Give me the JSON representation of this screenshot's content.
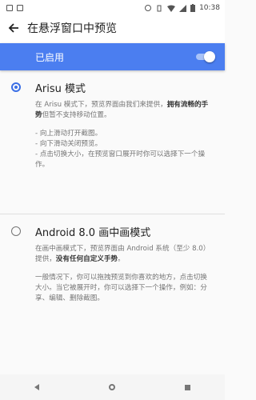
{
  "status_bar": {
    "time": "10:38"
  },
  "app_bar": {
    "title": "在悬浮窗口中预览"
  },
  "enabled_bar": {
    "label": "已启用",
    "toggle_on": true
  },
  "colors": {
    "accent": "#4b7ef0",
    "radio": "#3b6fe6"
  },
  "option1": {
    "title": "Arisu 模式",
    "desc_lead": "在 Arisu 模式下，预览界面由我们来提供，",
    "desc_bold": "拥有流畅的手势",
    "desc_tail": "但暂不支持移动位置。",
    "items": [
      "- 向上滑动打开截图。",
      "- 向下滑动关闭预览。",
      "- 点击切换大小，在预览窗口展开时你可以选择下一个操作。"
    ],
    "selected": true
  },
  "option2": {
    "title": "Android 8.0 画中画模式",
    "desc_lead": "在画中画模式下，预览界面由 Android 系统（至少 8.0）提供，",
    "desc_bold": "没有任何自定义手势",
    "desc_tail": "。",
    "note": "一般情况下，你可以拖拽预览到你喜欢的地方，点击切换大小。当它被展开时，你可以选择下一个操作，例如：分享、编辑、删除截图。",
    "selected": false
  }
}
